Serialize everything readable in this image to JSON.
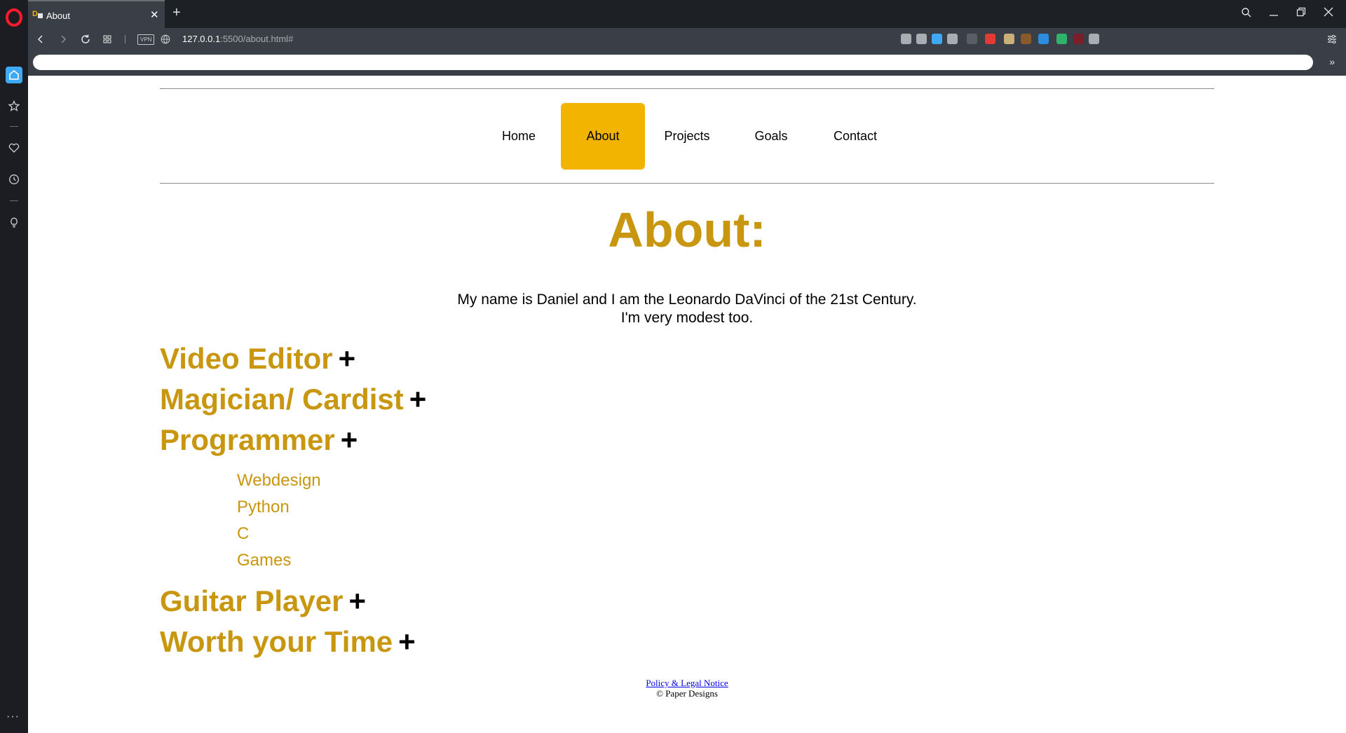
{
  "browser": {
    "tab": {
      "title": "About"
    },
    "address": {
      "host": "127.0.0.1",
      "path": ":5500/about.html#"
    },
    "vpn_label": "VPN",
    "new_tab_symbol": "+",
    "tab_close_symbol": "✕",
    "bookmarks_more": "»",
    "sidebar_more": "···",
    "sidebar_items": [
      "home-icon",
      "star-icon",
      "heart-icon",
      "history-icon",
      "lightbulb-icon"
    ],
    "extensions": [
      {
        "name": "share-icon",
        "color": "#a9acb1"
      },
      {
        "name": "camera-icon",
        "color": "#a9acb1"
      },
      {
        "name": "shield-icon",
        "color": "#3fa9f5"
      },
      {
        "name": "heart-icon",
        "color": "#a9acb1"
      },
      {
        "name": "off-extension-icon",
        "color": "#5a5d63"
      },
      {
        "name": "s-extension-icon",
        "color": "#e53935"
      },
      {
        "name": "image-extension-icon",
        "color": "#c8b07a"
      },
      {
        "name": "bird-extension-icon",
        "color": "#8a5a2b"
      },
      {
        "name": "globe-extension-icon",
        "color": "#2a8de0"
      },
      {
        "name": "refresh-extension-icon",
        "color": "#2fb36a"
      },
      {
        "name": "red-extension-icon",
        "color": "#7a1f2a"
      },
      {
        "name": "cube-icon",
        "color": "#a9acb1"
      }
    ]
  },
  "colors": {
    "accent": "#c8960f",
    "nav_active": "#f2b400",
    "opera_red": "#ff1b2d"
  },
  "nav": [
    {
      "label": "Home"
    },
    {
      "label": "About",
      "active": true
    },
    {
      "label": "Projects"
    },
    {
      "label": "Goals"
    },
    {
      "label": "Contact"
    }
  ],
  "main": {
    "title": "About:",
    "intro_line1": "My name is Daniel and I am the Leonardo DaVinci of the 21st Century.",
    "intro_line2": "I'm very modest too.",
    "expand_symbol": "+",
    "sections": [
      {
        "title": "Video Editor"
      },
      {
        "title": "Magician/ Cardist"
      },
      {
        "title": "Programmer",
        "items": [
          "Webdesign",
          "Python",
          "C",
          "Games"
        ]
      },
      {
        "title": "Guitar Player"
      },
      {
        "title": "Worth your Time"
      }
    ]
  },
  "footer": {
    "link": "Policy & Legal Notice",
    "copyright": "© Paper Designs"
  }
}
